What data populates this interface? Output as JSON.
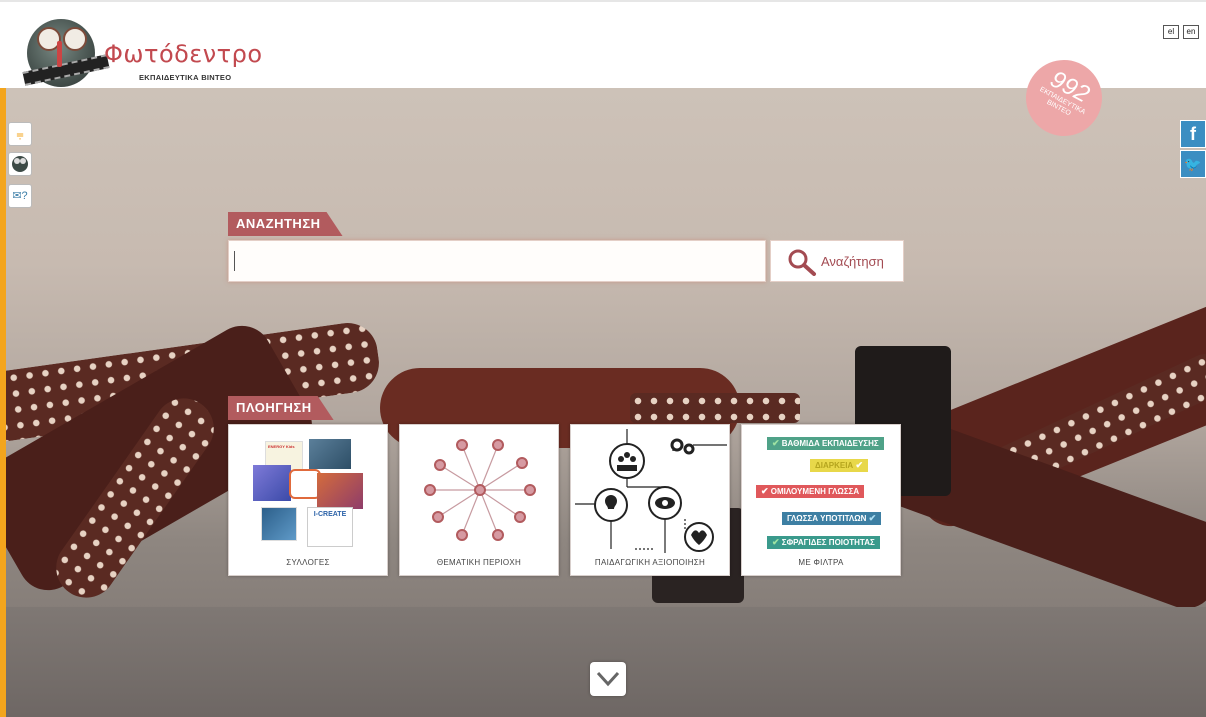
{
  "header": {
    "title": "Φωτόδεντρο",
    "subtitle": "ΕΚΠΑΙΔΕΥΤΙΚΑ ΒΙΝΤΕΟ",
    "languages": [
      "el",
      "en"
    ]
  },
  "badge": {
    "count": "992",
    "label": "ΕΚΠΑΙΔΕΥΤΙΚΑ ΒΙΝΤΕΟ"
  },
  "search": {
    "tag": "ΑΝΑΖΗΤΗΣΗ",
    "value": "",
    "button_label": "Αναζήτηση"
  },
  "browse": {
    "tag": "ΠΛΟΗΓΗΣΗ",
    "cards": [
      {
        "label": "ΣΥΛΛΟΓΕΣ"
      },
      {
        "label": "ΘΕΜΑΤΙΚΗ ΠΕΡΙΟΧΗ"
      },
      {
        "label": "ΠΑΙΔΑΓΩΓΙΚΗ ΑΞΙΟΠΟΙΗΣΗ"
      },
      {
        "label": "ΜΕ ΦΙΛΤΡΑ"
      }
    ],
    "collection_thumbs": {
      "energy": "ENERGY Kids",
      "icreate": "I-CREATE"
    },
    "filters": [
      {
        "label": "ΒΑΘΜΙΔΑ ΕΚΠΑΙΔΕΥΣΗΣ",
        "color": "#4fa288"
      },
      {
        "label": "ΔΙΑΡΚΕΙΑ",
        "color": "#e8d84a"
      },
      {
        "label": "ΟΜΙΛΟΥΜΕΝΗ ΓΛΩΣΣΑ",
        "color": "#e0585b"
      },
      {
        "label": "ΓΛΩΣΣΑ ΥΠΟΤΙΤΛΩΝ",
        "color": "#3d7fa3"
      },
      {
        "label": "ΣΦΡΑΓΙΔΕΣ ΠΟΙΟΤΗΤΑΣ",
        "color": "#3a9a8c"
      }
    ]
  },
  "colors": {
    "accent": "#b25b5e",
    "title": "#c2494f",
    "badge": "#eda7a8"
  },
  "icons": {
    "side": [
      "rss-icon",
      "tree-logo-icon",
      "mail-help-icon"
    ],
    "social": [
      "facebook-icon",
      "twitter-icon"
    ]
  }
}
